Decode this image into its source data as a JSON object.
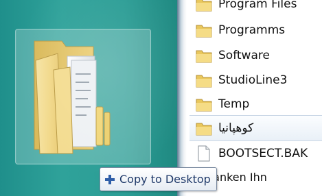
{
  "desktop": {
    "drag_icon": "folder-icon"
  },
  "file_list": {
    "items": [
      {
        "label": "Program Files",
        "icon": "folder-icon"
      },
      {
        "label": "Programms",
        "icon": "folder-icon"
      },
      {
        "label": "Software",
        "icon": "folder-icon"
      },
      {
        "label": "StudioLine3",
        "icon": "folder-icon"
      },
      {
        "label": "Temp",
        "icon": "folder-icon"
      },
      {
        "label": "کوهپانیا",
        "icon": "folder-icon"
      },
      {
        "label": "BOOTSECT.BAK",
        "icon": "file-icon"
      }
    ],
    "partial_text": "danken Ihn"
  },
  "tooltip": {
    "icon": "plus-icon",
    "label": "Copy to Desktop"
  },
  "colors": {
    "desktop_teal": "#2fa29a",
    "folder_yellow": "#f1d77a",
    "tooltip_text": "#203a6a"
  }
}
